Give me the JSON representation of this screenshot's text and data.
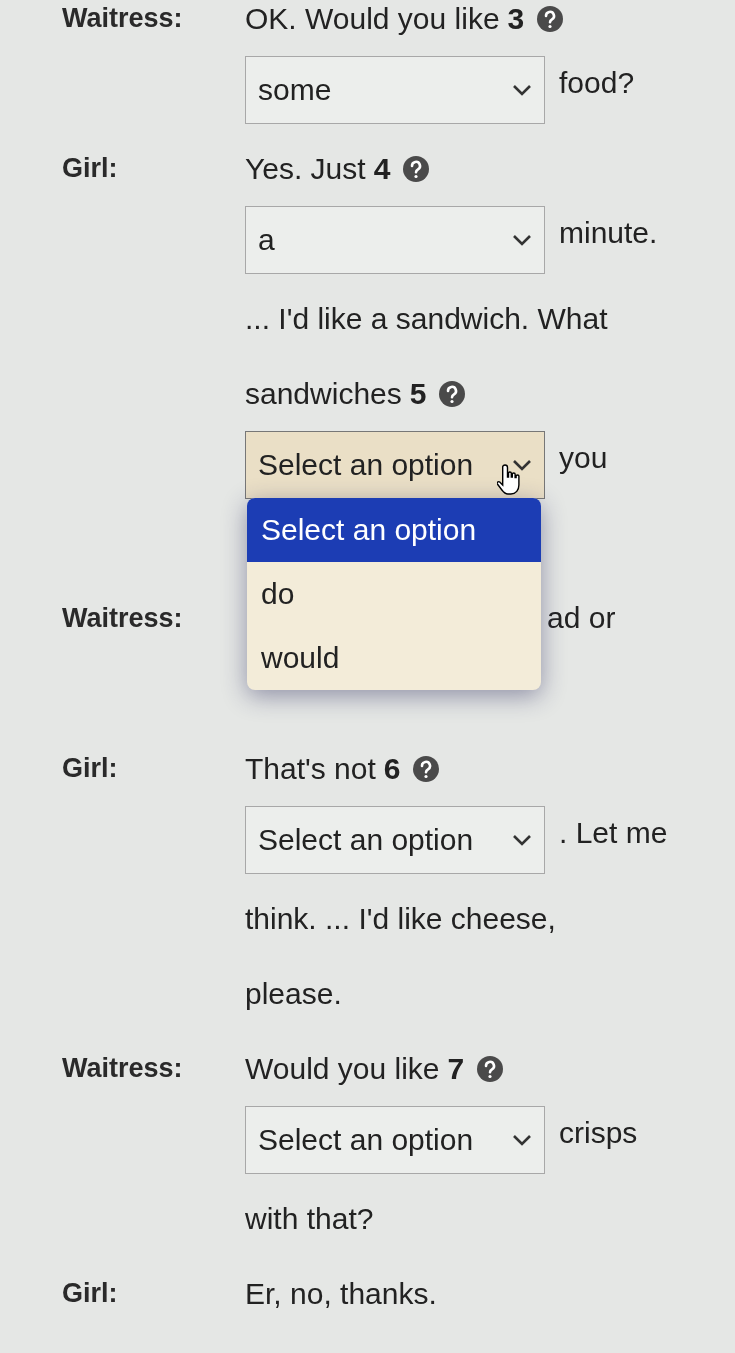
{
  "dialogue": [
    {
      "speaker": "Waitress:",
      "lines": [
        [
          {
            "kind": "text",
            "text": "OK. Would you like"
          },
          {
            "kind": "gap",
            "number": "3"
          }
        ],
        [
          {
            "kind": "select",
            "value": "some",
            "highlighted": false
          },
          {
            "kind": "text",
            "text": "food?"
          }
        ]
      ]
    },
    {
      "speaker": "Girl:",
      "lines": [
        [
          {
            "kind": "text",
            "text": "Yes. Just"
          },
          {
            "kind": "gap",
            "number": "4"
          }
        ],
        [
          {
            "kind": "select",
            "value": "a",
            "highlighted": false
          },
          {
            "kind": "text",
            "text": "minute."
          }
        ],
        [
          {
            "kind": "text",
            "text": "... I'd like a sandwich. What"
          }
        ],
        [
          {
            "kind": "text",
            "text": "sandwiches"
          },
          {
            "kind": "gap",
            "number": "5"
          }
        ],
        [
          {
            "kind": "select",
            "value": "Select an option",
            "highlighted": true,
            "open": true,
            "options": [
              {
                "label": "Select an option",
                "selected": true
              },
              {
                "label": "do",
                "selected": false
              },
              {
                "label": "would",
                "selected": false
              }
            ]
          },
          {
            "kind": "text",
            "text": "you"
          }
        ]
      ]
    },
    {
      "speaker": "Waitress:",
      "lines": [
        [
          {
            "kind": "tail",
            "text": "ad or"
          }
        ]
      ]
    },
    {
      "speaker": "Girl:",
      "lines": [
        [
          {
            "kind": "text",
            "text": "That's not"
          },
          {
            "kind": "gap",
            "number": "6"
          }
        ],
        [
          {
            "kind": "select",
            "value": "Select an option",
            "highlighted": false
          },
          {
            "kind": "text",
            "text": ". Let me"
          }
        ],
        [
          {
            "kind": "text",
            "text": "think. ... I'd like cheese,"
          }
        ],
        [
          {
            "kind": "text",
            "text": "please."
          }
        ]
      ]
    },
    {
      "speaker": "Waitress:",
      "lines": [
        [
          {
            "kind": "text",
            "text": "Would you like"
          },
          {
            "kind": "gap",
            "number": "7"
          }
        ],
        [
          {
            "kind": "select",
            "value": "Select an option",
            "highlighted": false
          },
          {
            "kind": "text",
            "text": "crisps"
          }
        ],
        [
          {
            "kind": "text",
            "text": "with that?"
          }
        ]
      ]
    },
    {
      "speaker": "Girl:",
      "lines": [
        [
          {
            "kind": "text",
            "text": "Er, no, thanks."
          }
        ]
      ]
    }
  ]
}
